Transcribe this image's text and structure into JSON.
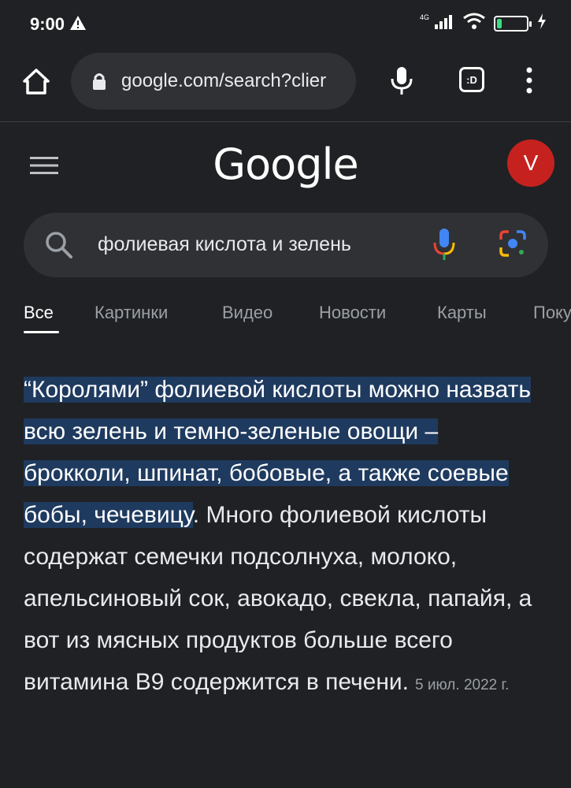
{
  "status_bar": {
    "time": "9:00",
    "network": "4G",
    "battery": "17",
    "battery_level": 0.17
  },
  "browser": {
    "url": "google.com/search?clier",
    "icons": [
      "home-icon",
      "lock-icon",
      "mic-icon",
      "tab-switcher-icon",
      "more-vert-icon"
    ],
    "tab_badge": ":D"
  },
  "google": {
    "logo_text": "Google",
    "avatar_letter": "V",
    "avatar_color": "#c5221f"
  },
  "search": {
    "query": "фолиевая кислота и зелень"
  },
  "tabs": [
    {
      "label": "Все",
      "active": true
    },
    {
      "label": "Картинки",
      "active": false
    },
    {
      "label": "Видео",
      "active": false
    },
    {
      "label": "Новости",
      "active": false
    },
    {
      "label": "Карты",
      "active": false
    },
    {
      "label": "Покупки",
      "active": false
    }
  ],
  "answer": {
    "highlighted": "“Королями” фолиевой кислоты можно назвать всю зелень и темно-зеленые овощи – брокколи, шпинат, бобовые, а также соевые бобы, чечевицу",
    "rest": ". Много фолиевой кислоты содержат семечки подсолнуха, молоко, апельсиновый сок, авокадо, свекла, папайя, а вот из мясных продуктов больше всего витамина B9 содержится в печени.",
    "date": "5 июл. 2022 г."
  },
  "colors": {
    "background": "#202124",
    "highlight": "#1f3a5f",
    "muted_text": "#9aa0a6"
  }
}
